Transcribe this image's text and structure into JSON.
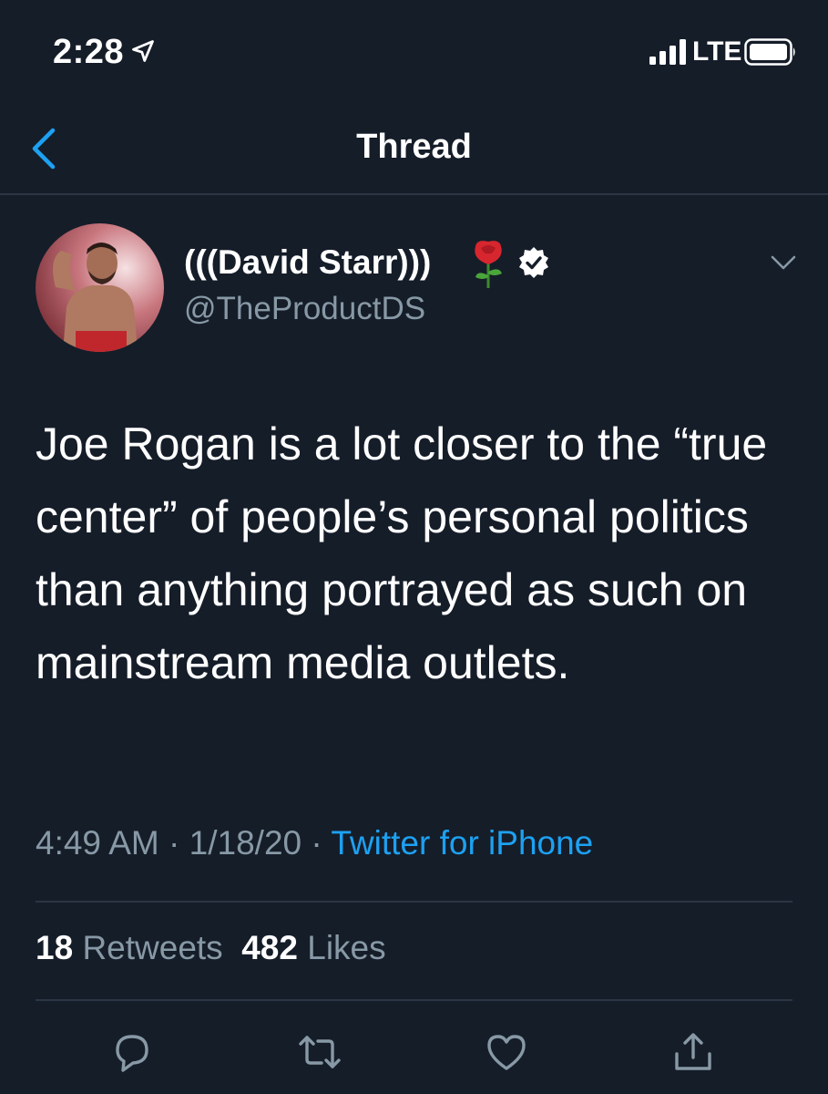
{
  "status_bar": {
    "time": "2:28",
    "network": "LTE"
  },
  "nav": {
    "title": "Thread"
  },
  "tweet": {
    "display_name": "(((David Starr)))",
    "handle": "@TheProductDS",
    "text": "Joe Rogan is a lot closer to the “true center” of people’s personal politics than anything portrayed as such on mainstream media outlets.",
    "time": "4:49 AM",
    "separator": "·",
    "date": "1/18/20",
    "source": "Twitter for iPhone",
    "retweets_count": "18",
    "retweets_label": "Retweets",
    "likes_count": "482",
    "likes_label": "Likes"
  },
  "icons": {
    "back": "chevron-left-icon",
    "caret": "chevron-down-icon",
    "reply": "reply-icon",
    "retweet": "retweet-icon",
    "like": "heart-icon",
    "share": "share-icon",
    "verified": "verified-badge-icon",
    "emoji": "rose-emoji"
  },
  "colors": {
    "background": "#151d29",
    "accent": "#1da1f2",
    "secondary_text": "#8899a6",
    "divider": "#2b3644"
  }
}
